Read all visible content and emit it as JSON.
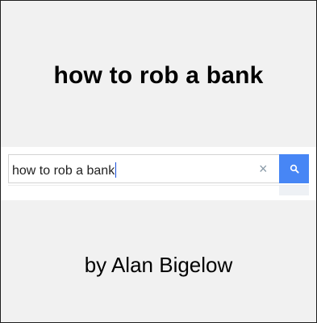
{
  "cover": {
    "title": "how to rob a bank",
    "author": "by Alan Bigelow"
  },
  "search": {
    "query": "how to rob a bank",
    "clear_glyph": "×",
    "clear_icon": "close-icon",
    "submit_icon": "search-icon"
  },
  "colors": {
    "background": "#f1f1f1",
    "search_button": "#4786f5",
    "caret": "#1a4fd8"
  }
}
